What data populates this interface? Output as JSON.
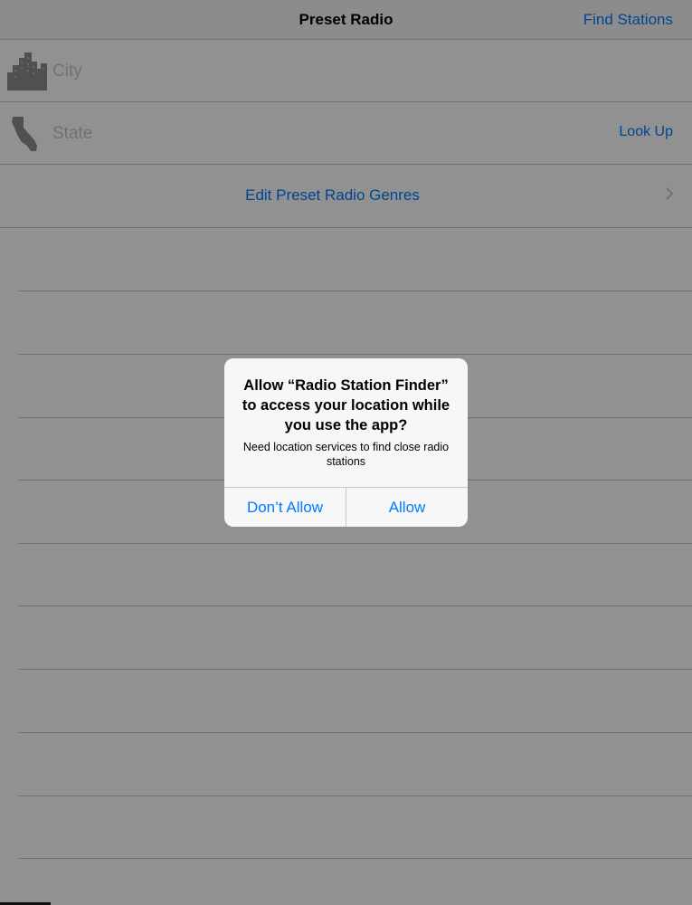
{
  "navbar": {
    "title": "Preset Radio",
    "right_button": "Find Stations"
  },
  "form": {
    "city": {
      "placeholder": "City",
      "value": "",
      "icon": "city-skyline-icon"
    },
    "state": {
      "placeholder": "State",
      "value": "",
      "icon": "california-state-icon",
      "lookup_label": "Look Up"
    },
    "genres": {
      "label": "Edit Preset Radio Genres",
      "icon": "chevron-right-icon"
    }
  },
  "alert": {
    "title": "Allow “Radio Station Finder” to access your location while you use the app?",
    "message": "Need location services to find close radio stations",
    "buttons": [
      "Don’t Allow",
      "Allow"
    ]
  },
  "colors": {
    "accent": "#007aff",
    "separator": "#c8c7cc",
    "placeholder": "#c7c7cd",
    "dialog_bg": "#f7f7f7"
  }
}
